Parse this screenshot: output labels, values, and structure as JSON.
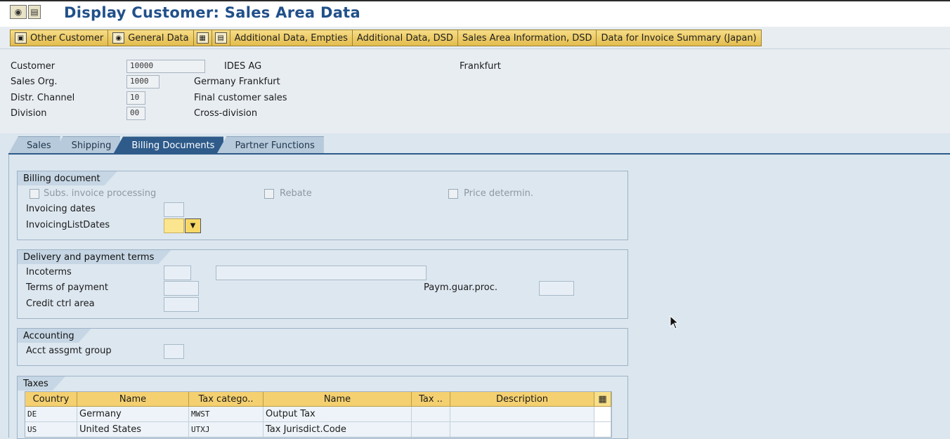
{
  "title": "Display Customer: Sales Area Data",
  "toolbar": {
    "other_customer": "Other Customer",
    "general_data": "General Data",
    "additional_empties": "Additional Data, Empties",
    "additional_dsd": "Additional Data, DSD",
    "sales_area_dsd": "Sales Area Information, DSD",
    "invoice_summary": "Data for Invoice Summary (Japan)"
  },
  "header": {
    "customer": {
      "label": "Customer",
      "value": "10000",
      "desc": "IDES AG",
      "city": "Frankfurt"
    },
    "sales_org": {
      "label": "Sales Org.",
      "value": "1000",
      "desc": "Germany Frankfurt"
    },
    "distr_channel": {
      "label": "Distr. Channel",
      "value": "10",
      "desc": "Final customer sales"
    },
    "division": {
      "label": "Division",
      "value": "00",
      "desc": "Cross-division"
    }
  },
  "tabs": [
    "Sales",
    "Shipping",
    "Billing Documents",
    "Partner Functions"
  ],
  "billing": {
    "title": "Billing document",
    "subs_invoice": "Subs. invoice processing",
    "rebate": "Rebate",
    "price_determin": "Price determin.",
    "invoicing_dates": "Invoicing dates",
    "invoicing_list_dates": "InvoicingListDates"
  },
  "delivery": {
    "title": "Delivery and payment terms",
    "incoterms": "Incoterms",
    "terms_of_payment": "Terms of payment",
    "credit_ctrl_area": "Credit ctrl area",
    "paym_guar_proc": "Paym.guar.proc."
  },
  "accounting": {
    "title": "Accounting",
    "acct_assgmt_group": "Acct assgmt group"
  },
  "taxes": {
    "title": "Taxes",
    "columns": [
      "Country",
      "Name",
      "Tax catego..",
      "Name",
      "Tax ..",
      "Description"
    ],
    "rows": [
      {
        "country": "DE",
        "name": "Germany",
        "category": "MWST",
        "cat_name": "Output Tax",
        "tax": "",
        "description": ""
      },
      {
        "country": "US",
        "name": "United States",
        "category": "UTXJ",
        "cat_name": "Tax Jurisdict.Code",
        "tax": "",
        "description": ""
      }
    ]
  }
}
